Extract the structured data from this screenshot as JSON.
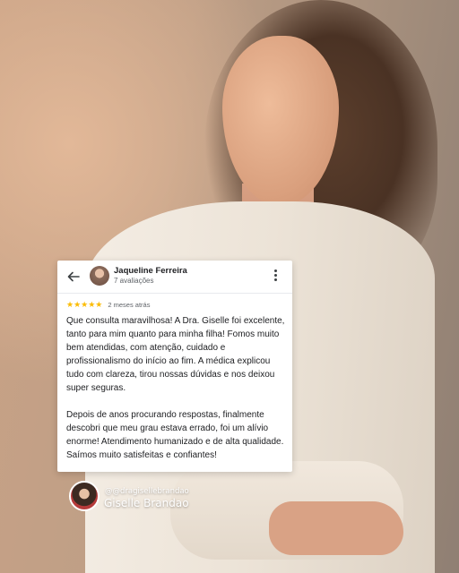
{
  "review": {
    "reviewer_name": "Jaqueline Ferreira",
    "reviewer_meta": "7 avaliações",
    "stars": "★★★★★",
    "rating": 5,
    "date": "2 meses atrás",
    "paragraphs": [
      "Que consulta maravilhosa! A Dra. Giselle foi excelente, tanto para mim quanto para minha filha! Fomos muito bem atendidas, com atenção, cuidado e profissionalismo do início ao fim. A médica explicou tudo com clareza, tirou nossas dúvidas e nos deixou super seguras.",
      "Depois de anos procurando respostas, finalmente descobri que meu grau estava errado, foi um alívio enorme! Atendimento humanizado e de alta qualidade. Saímos muito satisfeitas e confiantes!"
    ]
  },
  "profile": {
    "handle": "@@dragisellebrandao",
    "name": "Giselle Brandao"
  },
  "colors": {
    "star": "#fbbc04",
    "card_bg": "#ffffff",
    "text": "#202124",
    "muted": "#5f6368"
  },
  "icons": {
    "back": "arrow-left-icon",
    "more": "more-vertical-icon"
  }
}
